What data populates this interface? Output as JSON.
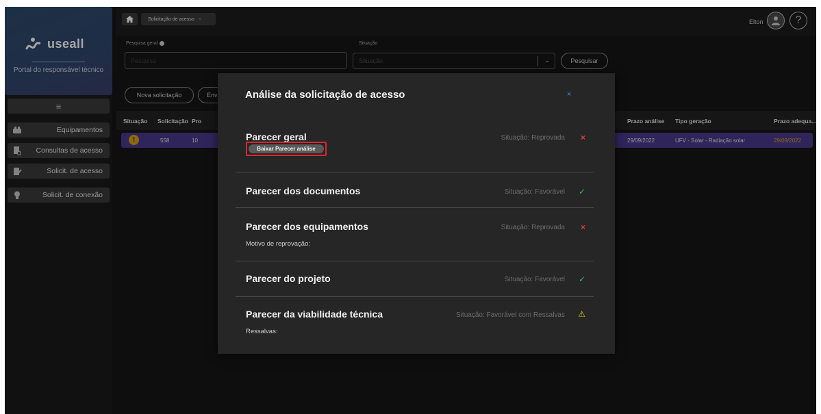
{
  "sidebar": {
    "brand_name": "useall",
    "subtitle": "Portal do responsável técnico",
    "menu_icon": "hamburger-icon",
    "items": [
      {
        "label": "Equipamentos",
        "icon": "equipment-icon"
      },
      {
        "label": "Consultas de acesso",
        "icon": "consult-icon"
      },
      {
        "label": "Solicit. de acesso",
        "icon": "request-icon"
      },
      {
        "label": "Solicit. de conexão",
        "icon": "lightbulb-icon"
      }
    ]
  },
  "topbar": {
    "tab_label": "Solicitação de acesso",
    "tab_close": "×",
    "user_name": "Elton"
  },
  "filters": {
    "search_label": "Pesquisa geral",
    "search_placeholder": "Pesquisa",
    "status_label": "Situação",
    "status_placeholder": "Situação",
    "search_button": "Pesquisar"
  },
  "actions": {
    "new_request": "Nova solicitação",
    "send": "Env"
  },
  "table": {
    "headers": {
      "situacao": "Situação",
      "solicitacao": "Solicitação",
      "pro": "Pro",
      "prazo_analise": "Prazo análise",
      "tipo_geracao": "Tipo geração",
      "prazo_adequacao": "Prazo adequa..."
    },
    "row": {
      "status_glyph": "!",
      "solicitacao": "558",
      "pro": "10",
      "prazo_analise": "29/09/2022",
      "tipo_geracao": "UFV - Solar - Radiação solar",
      "prazo_adequacao": "29/09/2022"
    }
  },
  "modal": {
    "title": "Análise da solicitação de acesso",
    "close": "×",
    "download_button": "Baixar Parecer análise",
    "sections": [
      {
        "title": "Parecer geral",
        "status": "Situação: Reprovada",
        "icon": "×"
      },
      {
        "title": "Parecer dos documentos",
        "status": "Situação: Favorável",
        "icon": "✓"
      },
      {
        "title": "Parecer dos equipamentos",
        "status": "Situação: Reprovada",
        "icon": "×",
        "sub": "Motivo de reprovação:"
      },
      {
        "title": "Parecer do projeto",
        "status": "Situação: Favorável",
        "icon": "✓"
      },
      {
        "title": "Parecer da viabilidade técnica",
        "status": "Situação: Favorável com Ressalvas",
        "icon": "⚠",
        "sub": "Ressalvas:"
      }
    ]
  },
  "colors": {
    "accent_row": "#4a3a8a",
    "reprovada": "#e03b3b",
    "favoravel": "#2ec24a",
    "ressalvas": "#f0c020",
    "prazo_adequacao": "#d9a020"
  }
}
